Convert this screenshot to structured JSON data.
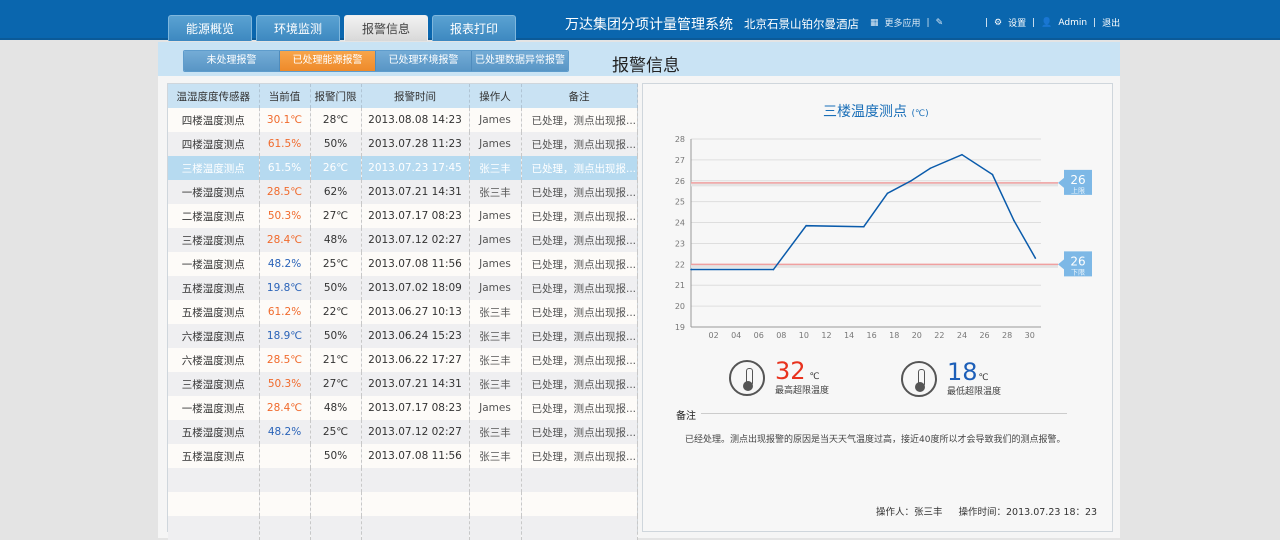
{
  "header": {
    "tabs": [
      {
        "label": "能源概览"
      },
      {
        "label": "环境监测"
      },
      {
        "label": "报警信息"
      },
      {
        "label": "报表打印"
      }
    ],
    "system_name": "万达集团分项计量管理系统",
    "hotel": "北京石景山铂尔曼酒店",
    "more_apps": "更多应用",
    "settings": "设置",
    "user": "Admin",
    "logout": "退出"
  },
  "subnav": {
    "tabs": [
      {
        "label": "未处理报警"
      },
      {
        "label": "已处理能源报警"
      },
      {
        "label": "已处理环境报警"
      },
      {
        "label": "已处理数据异常报警"
      }
    ],
    "page_title": "报警信息"
  },
  "table": {
    "columns": [
      "温湿度度传感器",
      "当前值",
      "报警门限",
      "报警时间",
      "操作人",
      "备注"
    ],
    "rows": [
      [
        "四楼温度测点",
        "30.1℃",
        "28℃",
        "2013.08.08  14:23",
        "James",
        "已处理，测点出现报...",
        "warm"
      ],
      [
        "四楼湿度测点",
        "61.5%",
        "50%",
        "2013.07.28  11:23",
        "James",
        "已处理，测点出现报...",
        "warm"
      ],
      [
        "三楼温度测点",
        "61.5%",
        "26℃",
        "2013.07.23  17:45",
        "张三丰",
        "已处理，测点出现报...",
        "warm"
      ],
      [
        "一楼湿度测点",
        "28.5℃",
        "62%",
        "2013.07.21  14:31",
        "张三丰",
        "已处理，测点出现报...",
        "warm"
      ],
      [
        "二楼温度测点",
        "50.3%",
        "27℃",
        "2013.07.17  08:23",
        "James",
        "已处理，测点出现报...",
        "warm"
      ],
      [
        "三楼湿度测点",
        "28.4℃",
        "48%",
        "2013.07.12  02:27",
        "James",
        "已处理，测点出现报...",
        "warm"
      ],
      [
        "一楼温度测点",
        "48.2%",
        "25℃",
        "2013.07.08  11:56",
        "James",
        "已处理，测点出现报...",
        "cool"
      ],
      [
        "五楼湿度测点",
        "19.8℃",
        "50%",
        "2013.07.02  18:09",
        "James",
        "已处理，测点出现报...",
        "cool"
      ],
      [
        "五楼温度测点",
        "61.2%",
        "22℃",
        "2013.06.27  10:13",
        "张三丰",
        "已处理，测点出现报...",
        "warm"
      ],
      [
        "六楼湿度测点",
        "18.9℃",
        "50%",
        "2013.06.24  15:23",
        "张三丰",
        "已处理，测点出现报...",
        "cool"
      ],
      [
        "六楼温度测点",
        "28.5℃",
        "21℃",
        "2013.06.22  17:27",
        "张三丰",
        "已处理，测点出现报...",
        "warm"
      ],
      [
        "三楼湿度测点",
        "50.3%",
        "27℃",
        "2013.07.21  14:31",
        "张三丰",
        "已处理，测点出现报...",
        "warm"
      ],
      [
        "一楼温度测点",
        "28.4℃",
        "48%",
        "2013.07.17  08:23",
        "James",
        "已处理，测点出现报...",
        "warm"
      ],
      [
        "五楼湿度测点",
        "48.2%",
        "25℃",
        "2013.07.12  02:27",
        "张三丰",
        "已处理，测点出现报...",
        "cool"
      ],
      [
        "五楼温度测点",
        "",
        "50%",
        "2013.07.08  11:56",
        "张三丰",
        "已处理，测点出现报...",
        ""
      ]
    ],
    "selected_index": 2,
    "empty_rows": 3
  },
  "colors": {
    "warm": "#f06a2c",
    "cool": "#2a63b8",
    "line": "#0a5bab",
    "limit": "#f0a0a0",
    "callout": "#7db8e6"
  },
  "chart_data": {
    "type": "line",
    "title": "三楼温度测点",
    "unit": "(℃)",
    "ylim": [
      19,
      28
    ],
    "yticks": [
      19,
      20,
      21,
      22,
      23,
      24,
      25,
      26,
      27,
      28
    ],
    "xticks": [
      "02",
      "04",
      "06",
      "08",
      "10",
      "12",
      "14",
      "16",
      "18",
      "20",
      "22",
      "24",
      "26",
      "28",
      "30"
    ],
    "xlim": [
      0,
      31
    ],
    "x": [
      0,
      7.3,
      10.2,
      15.3,
      17.4,
      19.5,
      21.2,
      24,
      26.7,
      28.6,
      30.5
    ],
    "y": [
      21.75,
      21.75,
      23.85,
      23.8,
      25.4,
      26.0,
      26.6,
      27.25,
      26.3,
      24.1,
      22.3
    ],
    "upper_limit": {
      "value": 25.9,
      "label": "26",
      "caption": "上限"
    },
    "lower_limit": {
      "value": 22.0,
      "label": "26",
      "caption": "下限"
    }
  },
  "stats": {
    "max": {
      "value": "32",
      "unit": "℃",
      "label": "最高超限温度"
    },
    "min": {
      "value": "18",
      "unit": "℃",
      "label": "最低超限温度"
    }
  },
  "note": {
    "heading": "备注",
    "text": "已经处理。测点出现报警的原因是当天天气温度过高，接近40度所以才会导致我们的测点报警。",
    "operator": "操作人：张三丰",
    "time": "操作时间：2013.07.23  18：23"
  }
}
